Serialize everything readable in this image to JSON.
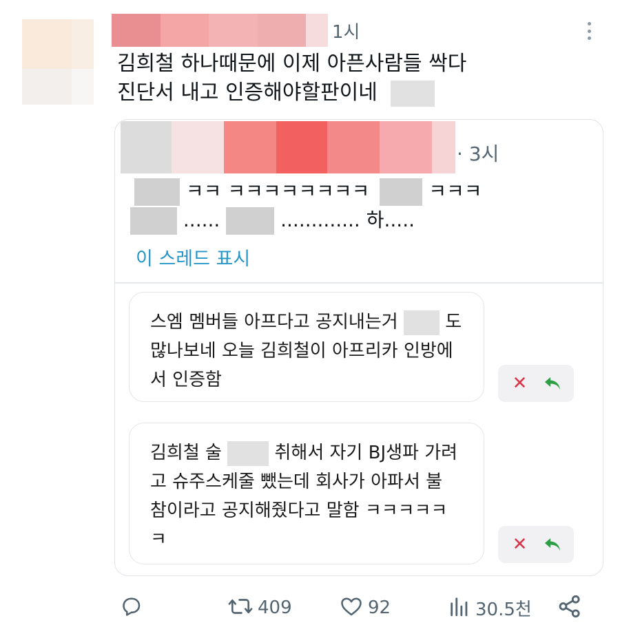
{
  "tweet": {
    "time": "1시",
    "text_line1": "김희철 하나때문에 이제 아픈사람들 싹다",
    "text_line2": "진단서 내고 인증해야할판이네"
  },
  "quote": {
    "time": "· 3시",
    "line1_a": "ㅋㅋ ㅋㅋㅋㅋㅋㅋㅋㅋ",
    "line1_b": "ㅋㅋㅋ",
    "line2_a": "......",
    "line2_b": "............. 하.....",
    "show_thread": "이 스레드 표시",
    "comments": [
      {
        "line1_a": "스엠 멤버들 아프다고 공지내는거",
        "line1_b": "도",
        "line2": "많나보네 오늘 김희철이 아프리카 인방에",
        "line3": "서 인증함"
      },
      {
        "line1_a": "김희철 술",
        "line1_b": "취해서 자기 BJ생파 가려",
        "line2": "고 슈주스케줄 뺐는데 회사가 아파서 불",
        "line3": "참이라고 공지해줬다고 말함 ㅋㅋㅋㅋㅋ",
        "line4": "ㅋ"
      }
    ]
  },
  "actions": {
    "reply_icon": "comment-icon",
    "retweet_icon": "retweet-icon",
    "retweets": "409",
    "like_icon": "heart-icon",
    "likes": "92",
    "views_icon": "bar-chart-icon",
    "views": "30.5천",
    "share_icon": "share-icon"
  },
  "colors": {
    "accent_link": "#2596c8",
    "secondary_text": "#536471",
    "close_red": "#d8344a",
    "reply_green": "#2e9e45"
  }
}
